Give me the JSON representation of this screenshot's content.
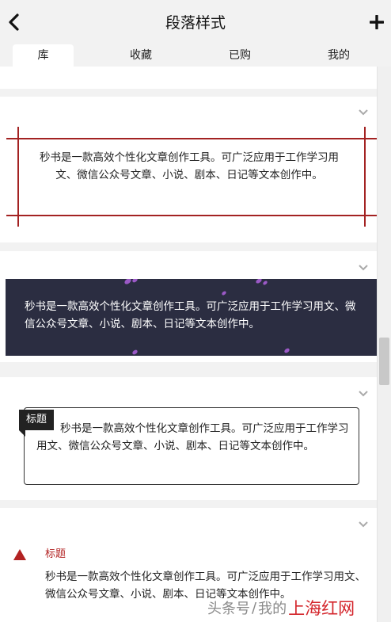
{
  "header": {
    "title": "段落样式"
  },
  "tabs": [
    {
      "label": "库",
      "active": true
    },
    {
      "label": "收藏",
      "active": false
    },
    {
      "label": "已购",
      "active": false
    },
    {
      "label": "我的",
      "active": false
    }
  ],
  "styles": {
    "style1": {
      "text": "秒书是一款高效个性化文章创作工具。可广泛应用于工作学习用文、微信公众号文章、小说、剧本、日记等文本创作中。"
    },
    "style2": {
      "text": "秒书是一款高效个性化文章创作工具。可广泛应用于工作学习用文、微信公众号文章、小说、剧本、日记等文本创作中。"
    },
    "style3": {
      "tag": "标题",
      "text": "秒书是一款高效个性化文章创作工具。可广泛应用于工作学习用文、微信公众号文章、小说、剧本、日记等文本创作中。"
    },
    "style4": {
      "title": "标题",
      "text": "秒书是一款高效个性化文章创作工具。可广泛应用于工作学习用文、微信公众号文章、小说、剧本、日记等文本创作中。"
    }
  },
  "watermark": {
    "prefix": "头条号",
    "sep": "/",
    "author": "我的",
    "brand": "上海红网"
  },
  "colors": {
    "accent_red": "#a32222",
    "dark_panel": "#2b2d41",
    "petal": "#9b59c6",
    "page_bg": "#f2f2f2"
  },
  "icons": {
    "back": "back-arrow-icon",
    "add": "plus-icon",
    "expand": "chevron-down-icon",
    "marker": "triangle-icon"
  }
}
